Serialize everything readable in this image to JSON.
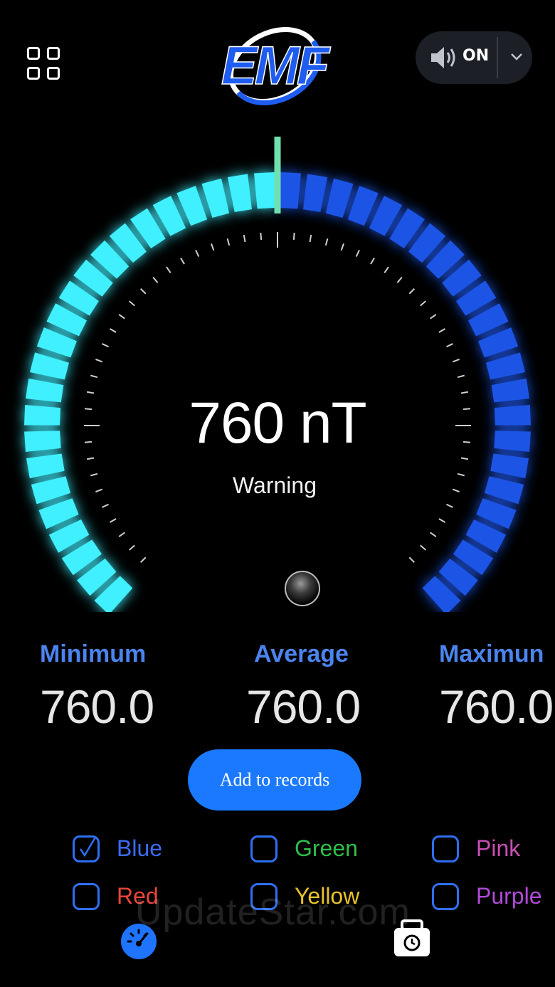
{
  "header": {
    "logo_text": "EMF",
    "sound_label": "ON",
    "icons": {
      "menu": "grid-icon",
      "sound": "speaker-icon",
      "dropdown": "chevron-down-icon"
    }
  },
  "gauge": {
    "reading": "760 nT",
    "status": "Warning",
    "level_fraction": 0.5,
    "colors": {
      "active": "#3ff0ff",
      "inactive": "#1f55e6",
      "needle": "#6fe0b0"
    }
  },
  "stats": {
    "minimum": {
      "label": "Minimum",
      "value": "760.0"
    },
    "average": {
      "label": "Average",
      "value": "760.0"
    },
    "maximum": {
      "label": "Maximun",
      "value": "760.0"
    }
  },
  "actions": {
    "add_records": "Add to records"
  },
  "color_options": [
    {
      "label": "Blue",
      "color": "#3a6cf5",
      "checked": true
    },
    {
      "label": "Green",
      "color": "#2fbf4a",
      "checked": false
    },
    {
      "label": "Pink",
      "color": "#c84fb5",
      "checked": false
    },
    {
      "label": "Red",
      "color": "#e8453a",
      "checked": false
    },
    {
      "label": "Yellow",
      "color": "#e8c22b",
      "checked": false
    },
    {
      "label": "Purple",
      "color": "#b04ad8",
      "checked": false
    }
  ],
  "nav": {
    "meter_icon": "speedometer-icon",
    "records_icon": "records-clock-icon"
  },
  "watermark": "UpdateStar.com"
}
